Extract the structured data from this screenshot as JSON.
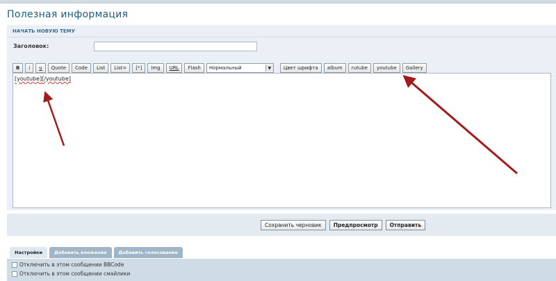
{
  "page": {
    "title": "Полезная информация"
  },
  "form": {
    "section_title": "НАЧАТЬ НОВУЮ ТЕМУ",
    "subject_label": "Заголовок:",
    "subject_value": ""
  },
  "toolbar": {
    "buttons_left": [
      "B",
      "i",
      "u",
      "Quote",
      "Code",
      "List",
      "List=",
      "[*]",
      "Img",
      "URL",
      "Flash"
    ],
    "font_size_selected": "Нормальный",
    "buttons_right": [
      "Цвет шрифта",
      "album",
      "rutube",
      "youtube",
      "Gallery"
    ]
  },
  "editor": {
    "tag_open": "[youtube]",
    "tag_close": "[/youtube]"
  },
  "submit": {
    "save_draft": "Сохранить черновик",
    "preview": "Предпросмотр",
    "send": "Отправить"
  },
  "tabs": [
    {
      "label": "Настройки",
      "active": true
    },
    {
      "label": "Добавить вложения",
      "active": false
    },
    {
      "label": "Добавить голосование",
      "active": false
    }
  ],
  "options": [
    {
      "label": "Отключить в этом сообщении BBCode",
      "checked": false
    },
    {
      "label": "Отключить в этом сообщении смайлики",
      "checked": false
    }
  ],
  "colors": {
    "arrow": "#a31a1a",
    "title": "#1d5a85",
    "panel": "#eaf0f5"
  }
}
